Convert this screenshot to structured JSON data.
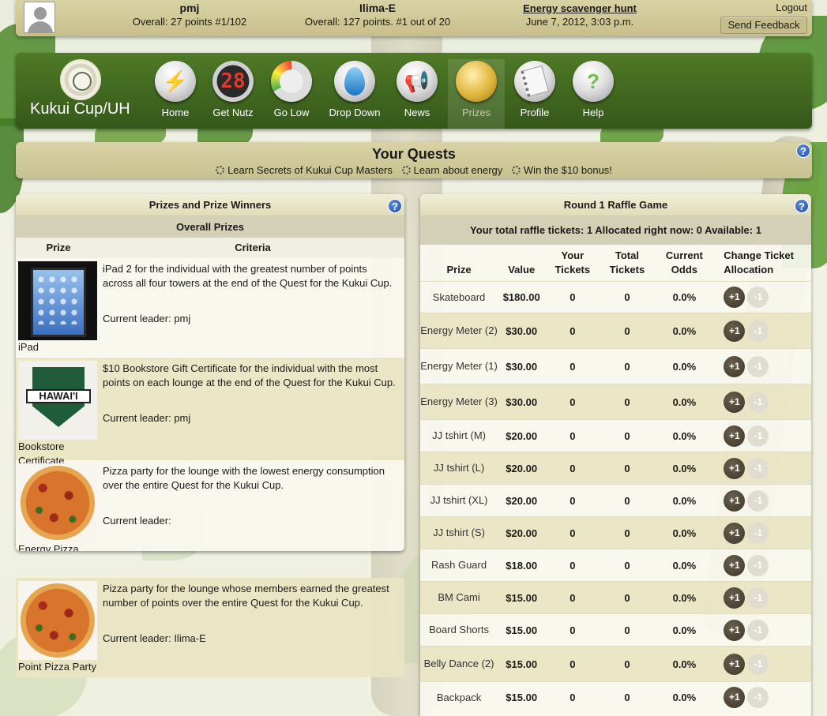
{
  "topbar": {
    "user": {
      "name": "pmj",
      "overall": "Overall: 27 points #1/102"
    },
    "team": {
      "name": "Ilima-E",
      "overall": "Overall: 127 points. #1 out of 20"
    },
    "event": {
      "name": "Energy scavenger hunt",
      "date": "June 7, 2012, 3:03 p.m."
    },
    "logout": "Logout",
    "feedback": "Send Feedback"
  },
  "nav": {
    "brand": "Kukui Cup/UH",
    "items": [
      {
        "label": "Home",
        "icon": "trophy-icon"
      },
      {
        "label": "Get Nutz",
        "icon": "scoreboard-icon"
      },
      {
        "label": "Go Low",
        "icon": "gauge-icon"
      },
      {
        "label": "Drop Down",
        "icon": "water-drop-icon"
      },
      {
        "label": "News",
        "icon": "megaphone-icon"
      },
      {
        "label": "Prizes",
        "icon": "medal-icon"
      },
      {
        "label": "Profile",
        "icon": "notebook-icon"
      },
      {
        "label": "Help",
        "icon": "question-icon"
      }
    ],
    "scoreboard_digits": "28",
    "help_glyph": "?",
    "active": "Prizes"
  },
  "quests": {
    "title": "Your Quests",
    "items": [
      "Learn Secrets of Kukui Cup Masters",
      "Learn about energy",
      "Win the $10 bonus!"
    ]
  },
  "prizes_panel": {
    "title": "Prizes and Prize Winners",
    "subtitle": "Overall Prizes",
    "col_prize": "Prize",
    "col_criteria": "Criteria",
    "rows": [
      {
        "name": "iPad",
        "criteria": "iPad 2 for the individual with the greatest number of points across all four towers at the end of the Quest for the Kukui Cup.",
        "leader": "Current leader: pmj"
      },
      {
        "name": "Bookstore Certificate",
        "criteria": "$10 Bookstore Gift Certificate for the individual with the most points on each lounge at the end of the Quest for the Kukui Cup.",
        "leader": "Current leader: pmj"
      },
      {
        "name": "Energy Pizza Party",
        "criteria": "Pizza party for the lounge with the lowest energy consumption over the entire Quest for the Kukui Cup.",
        "leader": "Current leader:"
      },
      {
        "name": "Point Pizza Party",
        "criteria": "Pizza party for the lounge whose members earned the greatest number of points over the entire Quest for the Kukui Cup.",
        "leader": "Current leader: Ilima-E"
      }
    ],
    "bookstore_logo_text": "HAWAI'I"
  },
  "raffle_panel": {
    "title": "Round 1 Raffle Game",
    "summary": "Your total raffle tickets: 1 Allocated right now: 0 Available: 1",
    "columns": [
      "Prize",
      "Value",
      "Your Tickets",
      "Total Tickets",
      "Current Odds",
      "Change Ticket Allocation"
    ],
    "plus_label": "+1",
    "minus_label": "-1",
    "rows": [
      {
        "prize": "Skateboard",
        "value": "$180.00",
        "your": "0",
        "total": "0",
        "odds": "0.0%"
      },
      {
        "prize": "Energy Meter (2)",
        "value": "$30.00",
        "your": "0",
        "total": "0",
        "odds": "0.0%"
      },
      {
        "prize": "Energy Meter (1)",
        "value": "$30.00",
        "your": "0",
        "total": "0",
        "odds": "0.0%"
      },
      {
        "prize": "Energy Meter (3)",
        "value": "$30.00",
        "your": "0",
        "total": "0",
        "odds": "0.0%"
      },
      {
        "prize": "JJ tshirt (M)",
        "value": "$20.00",
        "your": "0",
        "total": "0",
        "odds": "0.0%"
      },
      {
        "prize": "JJ tshirt (L)",
        "value": "$20.00",
        "your": "0",
        "total": "0",
        "odds": "0.0%"
      },
      {
        "prize": "JJ tshirt (XL)",
        "value": "$20.00",
        "your": "0",
        "total": "0",
        "odds": "0.0%"
      },
      {
        "prize": "JJ tshirt (S)",
        "value": "$20.00",
        "your": "0",
        "total": "0",
        "odds": "0.0%"
      },
      {
        "prize": "Rash Guard",
        "value": "$18.00",
        "your": "0",
        "total": "0",
        "odds": "0.0%"
      },
      {
        "prize": "BM Cami",
        "value": "$15.00",
        "your": "0",
        "total": "0",
        "odds": "0.0%"
      },
      {
        "prize": "Board Shorts",
        "value": "$15.00",
        "your": "0",
        "total": "0",
        "odds": "0.0%"
      },
      {
        "prize": "Belly Dance (2)",
        "value": "$15.00",
        "your": "0",
        "total": "0",
        "odds": "0.0%"
      },
      {
        "prize": "Backpack",
        "value": "$15.00",
        "your": "0",
        "total": "0",
        "odds": "0.0%"
      }
    ]
  },
  "colors": {
    "nav_green": "#3f6a1f",
    "bar_tan": "#cfc897",
    "plus_button": "#4a4236",
    "minus_button": "#e0ddd0",
    "help_blue": "#2a5cb5"
  }
}
